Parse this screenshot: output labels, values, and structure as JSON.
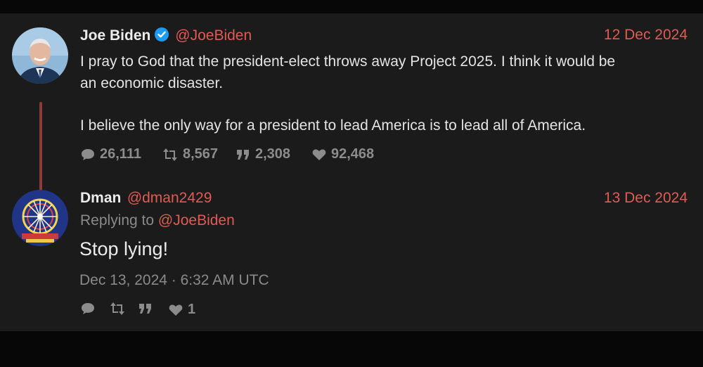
{
  "tweet": {
    "author_name": "Joe Biden",
    "author_handle": "@JoeBiden",
    "date": "12 Dec 2024",
    "text_line1": "I pray to God that the president-elect throws away Project 2025. I think it would be",
    "text_line2": "an economic disaster.",
    "text_line3": "I believe the only way for a president to lead America is to lead all of America.",
    "replies": "26,111",
    "retweets": "8,567",
    "quotes": "2,308",
    "likes": "92,468"
  },
  "reply": {
    "author_name": "Dman",
    "author_handle": "@dman2429",
    "date": "13 Dec 2024",
    "replying_to_prefix": "Replying to",
    "replying_to_handle": "@JoeBiden",
    "text": "Stop lying!",
    "timestamp": "Dec 13, 2024 · 6:32 AM UTC",
    "likes": "1"
  },
  "colors": {
    "accent": "#e25a52",
    "panel": "#1b1b1c",
    "verified": "#1d9bf0"
  }
}
